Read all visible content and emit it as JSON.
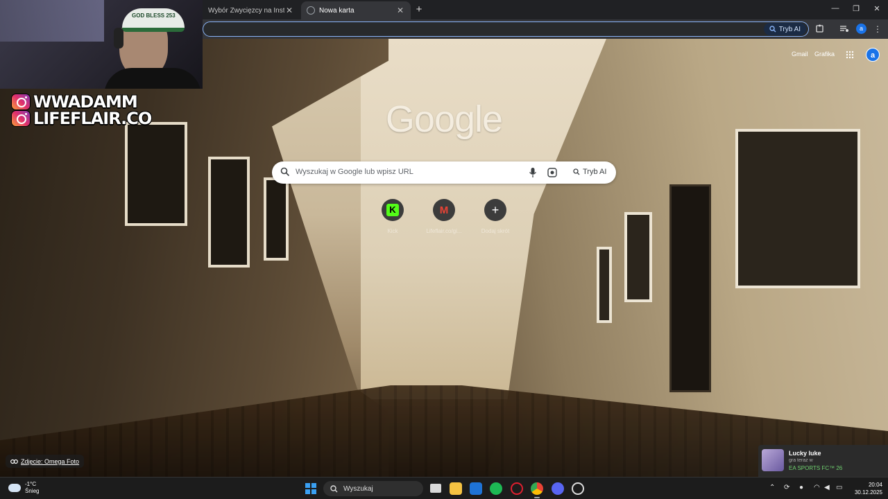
{
  "tabs": [
    {
      "label": "Wybór Zwycięzcy na Instagram"
    },
    {
      "label": "Nowa karta"
    }
  ],
  "toolbar": {
    "ai_mode_label": "Tryb AI",
    "profile_initial": "a"
  },
  "ntp": {
    "logo_text": "Google",
    "search_placeholder": "Wyszukaj w Google lub wpisz URL",
    "ai_mode_label": "Tryb AI",
    "top_links": {
      "gmail": "Gmail",
      "images": "Grafika"
    },
    "profile_initial": "a",
    "shortcuts": [
      {
        "label": "Kick",
        "icon": "kick-icon",
        "glyph": "K"
      },
      {
        "label": "Lifeflair.co/gi...",
        "icon": "gmail-icon",
        "glyph": "M"
      },
      {
        "label": "Dodaj skrót",
        "icon": "plus-icon",
        "glyph": "+"
      }
    ],
    "photo_credit": "Zdjęcie: Omega Foto"
  },
  "overlay": {
    "handles": [
      "WWADAMM",
      "LIFEFLAIR.CO"
    ],
    "cap_text": "GOD BLESS 253"
  },
  "notification": {
    "name": "Lucky luke",
    "status": "gra teraz w",
    "game": "EA SPORTS FC™ 26"
  },
  "taskbar": {
    "weather_temp": "-1°C",
    "weather_desc": "Śnieg",
    "search_label": "Wyszukaj",
    "time": "20:04",
    "date": "30.12.2025"
  }
}
